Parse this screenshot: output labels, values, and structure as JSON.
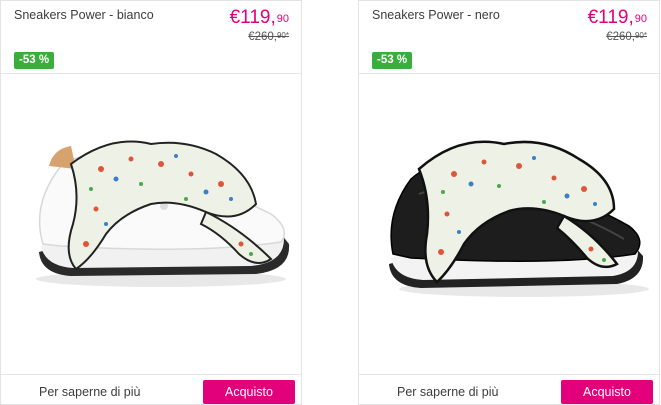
{
  "products": [
    {
      "title": "Sneakers Power - bianco",
      "price_main": "€119,",
      "price_cents": "90",
      "old_price_main": "€260,",
      "old_price_cents": "90*",
      "discount": "-53 %",
      "more_label": "Per saperne di più",
      "buy_label": "Acquisto",
      "shoe_color": "white"
    },
    {
      "title": "Sneakers Power - nero",
      "price_main": "€119,",
      "price_cents": "90",
      "old_price_main": "€260,",
      "old_price_cents": "90*",
      "discount": "-53 %",
      "more_label": "Per saperne di più",
      "buy_label": "Acquisto",
      "shoe_color": "black"
    }
  ],
  "colors": {
    "accent": "#e3007b",
    "badge": "#3aad3d"
  }
}
